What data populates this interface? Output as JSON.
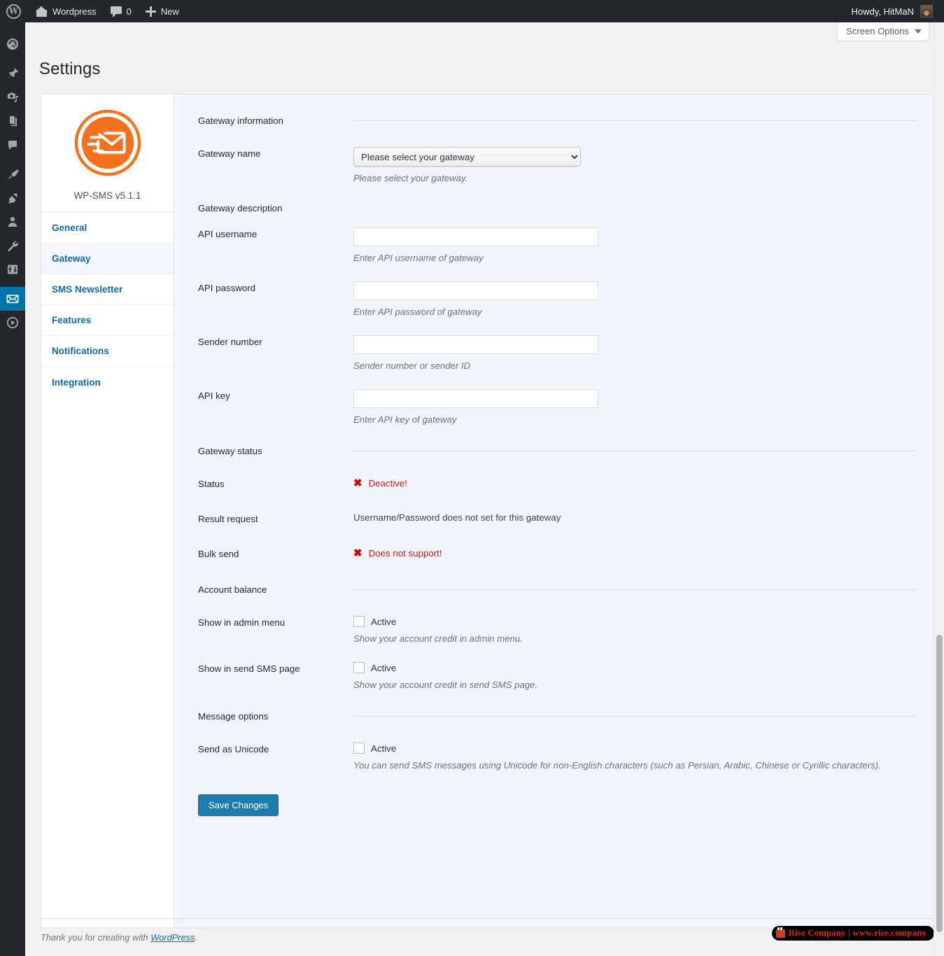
{
  "adminbar": {
    "logo_icon": "wordpress-logo-icon",
    "site_name": "Wordpress",
    "home_icon": "home-icon",
    "comments_icon": "comment-bubble-icon",
    "comments_count": "0",
    "new_icon": "plus-icon",
    "new_label": "New",
    "howdy": "Howdy, HitMaN",
    "avatar_icon": "user-avatar"
  },
  "adminmenu": {
    "items": [
      {
        "icon": "dashboard-gauge-icon",
        "active": false
      },
      {
        "icon": "pushpin-posts-icon",
        "active": false
      },
      {
        "icon": "media-camera-music-icon",
        "active": false
      },
      {
        "icon": "pages-copy-icon",
        "active": false
      },
      {
        "icon": "comments-bubble-icon",
        "active": false
      },
      {
        "icon": "appearance-paintbrush-icon",
        "active": false
      },
      {
        "icon": "plugins-plug-icon",
        "active": false
      },
      {
        "icon": "users-person-icon",
        "active": false
      },
      {
        "icon": "tools-wrench-icon",
        "active": false
      },
      {
        "icon": "settings-sliders-icon",
        "active": false
      },
      {
        "icon": "sms-envelope-icon",
        "active": true
      },
      {
        "icon": "collapse-play-icon",
        "active": false
      }
    ]
  },
  "screen_meta": {
    "screen_options_label": "Screen Options",
    "caret_icon": "chevron-down-icon"
  },
  "page": {
    "title": "Settings"
  },
  "sidebar": {
    "logo_icon": "wp-sms-envelope-logo",
    "brand_title": "WP-SMS v5.1.1",
    "items": [
      {
        "label": "General",
        "active": false
      },
      {
        "label": "Gateway",
        "active": true
      },
      {
        "label": "SMS Newsletter",
        "active": false
      },
      {
        "label": "Features",
        "active": false
      },
      {
        "label": "Notifications",
        "active": false
      },
      {
        "label": "Integration",
        "active": false
      }
    ]
  },
  "form": {
    "sections": {
      "gateway_information": "Gateway information",
      "gateway_status": "Gateway status",
      "account_balance": "Account balance",
      "message_options": "Message options"
    },
    "gateway_name": {
      "label": "Gateway name",
      "selected": "Please select your gateway",
      "options": [
        "Please select your gateway"
      ],
      "hint": "Please select your gateway."
    },
    "gateway_description": {
      "label": "Gateway description",
      "value": ""
    },
    "api_username": {
      "label": "API username",
      "value": "",
      "placeholder": "",
      "hint": "Enter API username of gateway"
    },
    "api_password": {
      "label": "API password",
      "value": "",
      "placeholder": "",
      "hint": "Enter API password of gateway"
    },
    "sender_number": {
      "label": "Sender number",
      "value": "",
      "placeholder": "",
      "hint": "Sender number or sender ID"
    },
    "api_key": {
      "label": "API key",
      "value": "",
      "placeholder": "",
      "hint": "Enter API key of gateway"
    },
    "status": {
      "label": "Status",
      "icon": "x-mark-icon",
      "value": "Deactive!",
      "color": "#d11919"
    },
    "result_request": {
      "label": "Result request",
      "value": "Username/Password does not set for this gateway"
    },
    "bulk_send": {
      "label": "Bulk send",
      "icon": "x-mark-icon",
      "value": "Does not support!",
      "color": "#d11919"
    },
    "show_in_admin_menu": {
      "label": "Show in admin menu",
      "checkbox_label": "Active",
      "checked": false,
      "hint": "Show your account credit in admin menu."
    },
    "show_in_send_sms_page": {
      "label": "Show in send SMS page",
      "checkbox_label": "Active",
      "checked": false,
      "hint": "Show your account credit in send SMS page."
    },
    "send_as_unicode": {
      "label": "Send as Unicode",
      "checkbox_label": "Active",
      "checked": false,
      "hint": "You can send SMS messages using Unicode for non-English characters (such as Persian, Arabic, Chinese or Cyrillic characters)."
    },
    "save_label": "Save Changes"
  },
  "footer": {
    "thanks_prefix": "Thank you for creating with ",
    "wordpress_link": "WordPress",
    "thanks_suffix": ".",
    "badge_icon": "rise-company-icon",
    "badge_text": "Rise Company | www.rise.company"
  },
  "colors": {
    "admin_dark": "#23282d",
    "accent_blue": "#0073aa",
    "panel_bg": "#f2f5fc",
    "brand_orange": "#f4721e",
    "danger_red": "#d11919",
    "link_blue": "#0e6ba8"
  }
}
